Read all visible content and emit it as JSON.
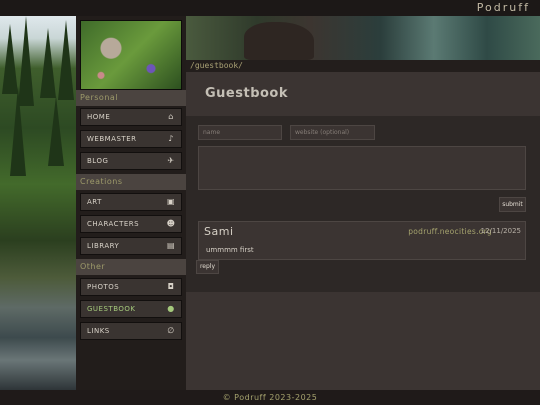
{
  "site": {
    "title": "Podruff"
  },
  "breadcrumb": {
    "path": "/guestbook/"
  },
  "sidebar": {
    "sections": [
      {
        "label": "Personal"
      },
      {
        "label": "Creations"
      },
      {
        "label": "Other"
      }
    ],
    "items": [
      {
        "label": "HOME",
        "icon": "house-icon"
      },
      {
        "label": "WEBMASTER",
        "icon": "bell-icon"
      },
      {
        "label": "BLOG",
        "icon": "plane-icon"
      },
      {
        "label": "ART",
        "icon": "image-icon"
      },
      {
        "label": "CHARACTERS",
        "icon": "users-icon"
      },
      {
        "label": "LIBRARY",
        "icon": "book-icon"
      },
      {
        "label": "PHOTOS",
        "icon": "camera-icon"
      },
      {
        "label": "GUESTBOOK",
        "icon": "speech-bubble-icon",
        "active": true
      },
      {
        "label": "LINKS",
        "icon": "paperclip-icon"
      }
    ],
    "active_color": "#a5c97c"
  },
  "main": {
    "title": "Guestbook",
    "form": {
      "name_placeholder": "name",
      "website_placeholder": "website (optional)",
      "submit_label": "submit"
    },
    "entries": [
      {
        "name": "Sami",
        "website": "podruff.neocities.org",
        "date": "12/11/2025",
        "message": "ummmm first",
        "reply_label": "reply"
      }
    ]
  },
  "footer": {
    "text": "© Podruff 2023-2025"
  }
}
